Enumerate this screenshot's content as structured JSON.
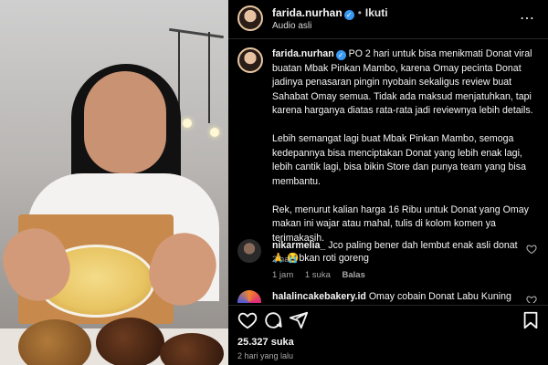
{
  "header": {
    "username": "farida.nurhan",
    "separator": "•",
    "follow_label": "Ikuti",
    "audio_label": "Audio asli",
    "more_label": "⋯"
  },
  "caption": {
    "username": "farida.nurhan",
    "paragraphs": [
      "PO 2 hari untuk bisa menikmati Donat viral buatan Mbak Pinkan Mambo, karena Omay pecinta Donat jadinya penasaran pingin nyobain sekaligus review buat Sahabat Omay semua. Tidak ada maksud menjatuhkan, tapi karena harganya diatas rata-rata jadi reviewnya lebih details.",
      "Lebih semangat lagi buat Mbak Pinkan Mambo, semoga kedepannya bisa menciptakan Donat yang lebih enak lagi, lebih cantik lagi, bisa bikin Store dan punya team yang bisa membantu.",
      "Rek, menurut kalian harga 16 Ribu untuk Donat yang Omay makan ini wajar atau mahal, tulis di kolom komen ya terimakasih."
    ],
    "time": "2 hari"
  },
  "comments": [
    {
      "username": "nikarmelia_",
      "text": "Jco paling bener dah lembut enak asli donat🙏 😭bkan roti goreng",
      "time": "1 jam",
      "likes": "1 suka",
      "reply_label": "Balas"
    },
    {
      "username": "halalincakebakery.id",
      "text": "Omay cobain Donat Labu Kuning kita"
    }
  ],
  "footer": {
    "likes": "25.327 suka",
    "posted": "2 hari yang lalu"
  },
  "colors": {
    "background": "#000000",
    "verified": "#3897f0",
    "muted_text": "#a8a8a8"
  },
  "icons": [
    "heart-icon",
    "comment-icon",
    "share-icon",
    "bookmark-icon",
    "more-icon",
    "verified-icon"
  ]
}
